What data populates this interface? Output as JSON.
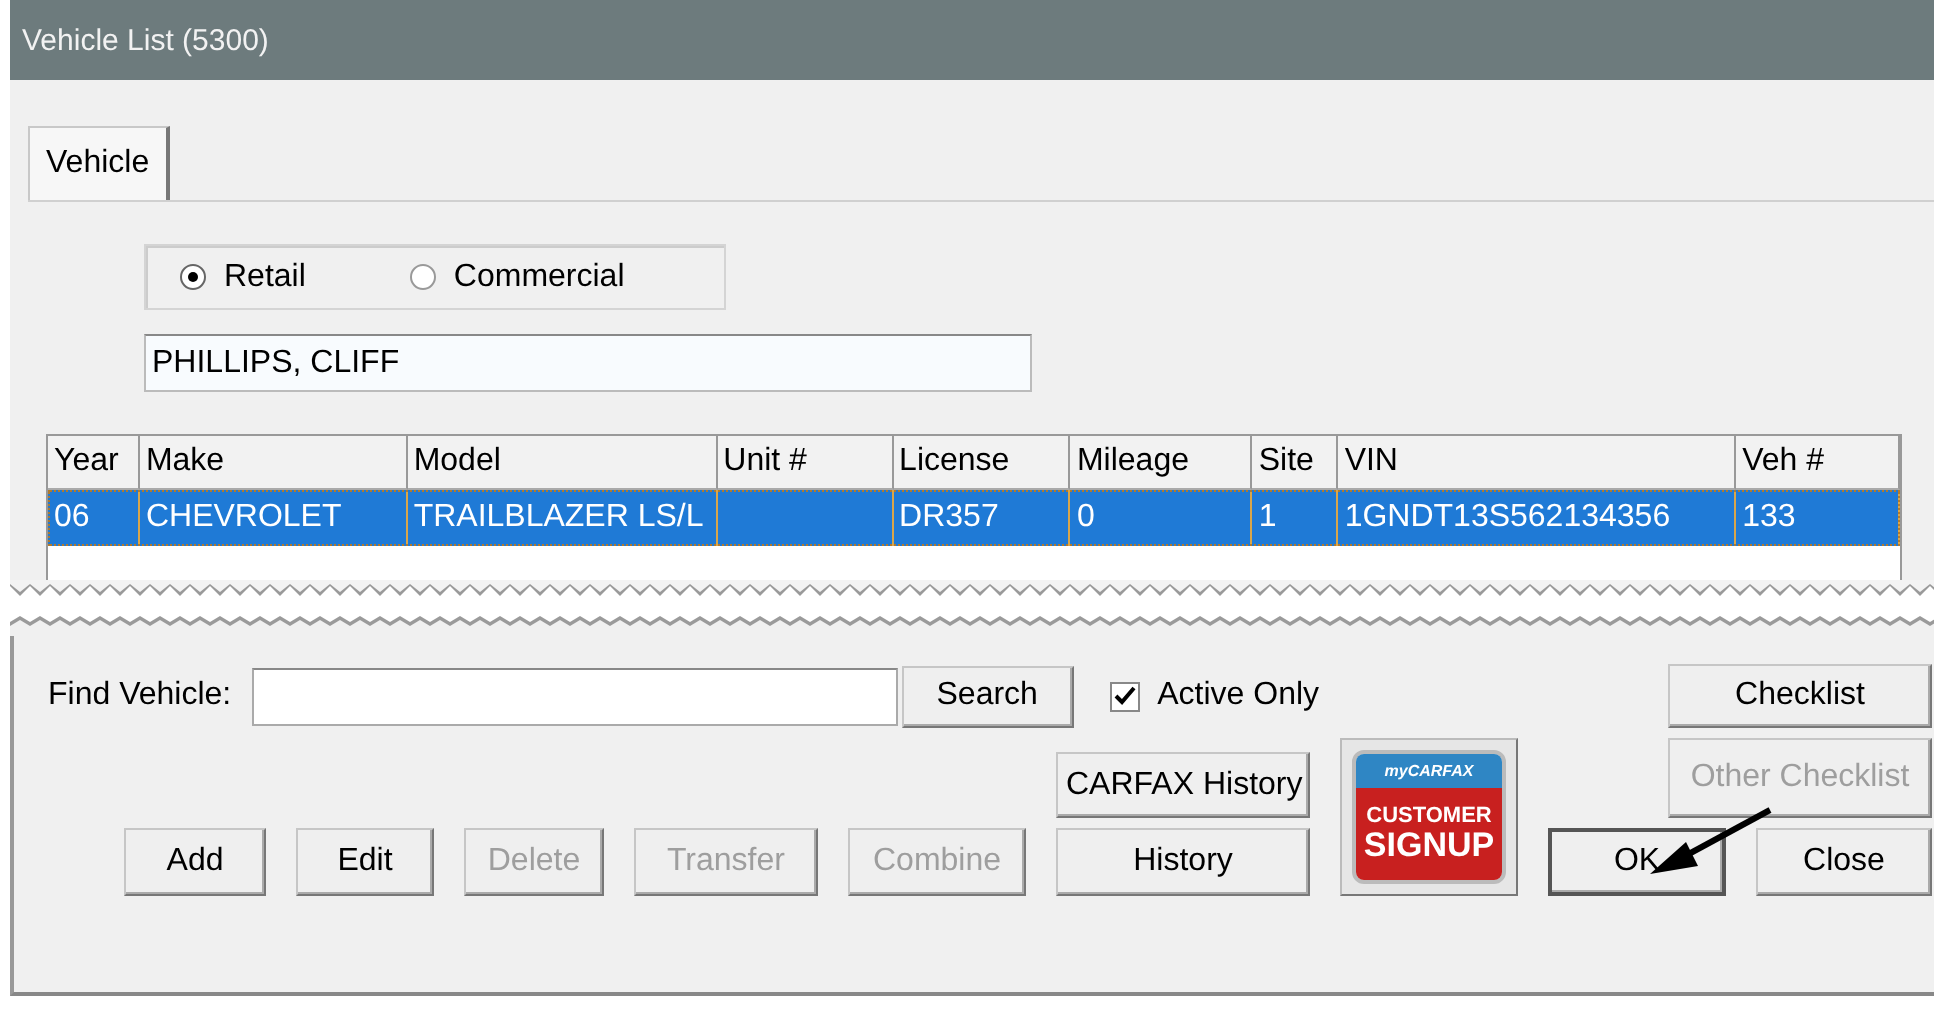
{
  "window": {
    "title": "Vehicle List (5300)"
  },
  "tabs": [
    {
      "label": "Vehicle",
      "selected": true
    }
  ],
  "customer_type": [
    {
      "label": "Retail",
      "selected": true
    },
    {
      "label": "Commercial",
      "selected": false
    }
  ],
  "customer_name": {
    "value": "PHILLIPS, CLIFF"
  },
  "table": {
    "columns": [
      "Year",
      "Make",
      "Model",
      "Unit #",
      "License",
      "Mileage",
      "Site",
      "VIN",
      "Veh #"
    ],
    "rows": [
      {
        "selected": true,
        "cells": [
          "06",
          "CHEVROLET",
          "TRAILBLAZER LS/L",
          "",
          "DR357",
          "0",
          "1",
          "1GNDT13S562134356",
          "133"
        ]
      }
    ]
  },
  "find": {
    "label": "Find Vehicle:"
  },
  "search_button": {
    "label": "Search"
  },
  "active_only": {
    "label": "Active Only",
    "checked": true
  },
  "carfax_history_button": {
    "label": "CARFAX History"
  },
  "signup_logo": {
    "top": "myCARFAX",
    "line1": "CUSTOMER",
    "line2": "SIGNUP"
  },
  "checklist_buttons": [
    {
      "label": "Checklist",
      "disabled": false
    },
    {
      "label": "Other Checklist",
      "disabled": true
    }
  ],
  "action_buttons": [
    {
      "label": "Add",
      "disabled": false
    },
    {
      "label": "Edit",
      "disabled": false
    },
    {
      "label": "Delete",
      "disabled": true
    },
    {
      "label": "Transfer",
      "disabled": true
    },
    {
      "label": "Combine",
      "disabled": true
    },
    {
      "label": "History",
      "disabled": false
    }
  ],
  "dialog_buttons": [
    {
      "label": "OK",
      "default": true
    },
    {
      "label": "Close",
      "default": false
    }
  ]
}
